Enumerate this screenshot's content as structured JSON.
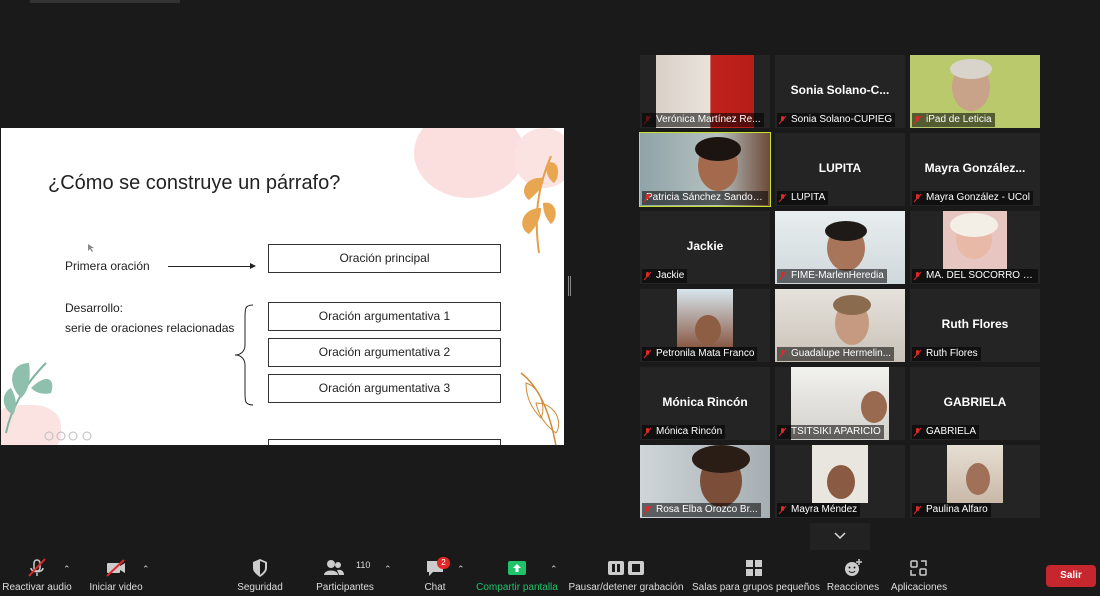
{
  "slide": {
    "title": "¿Cómo se construye un párrafo?",
    "left_labels": {
      "primera": "Primera oración",
      "desarrollo": "Desarrollo:",
      "serie": "serie de oraciones relacionadas"
    },
    "boxes": [
      "Oración principal",
      "Oración argumentativa 1",
      "Oración argumentativa 2",
      "Oración argumentativa 3"
    ]
  },
  "participants": [
    {
      "name": "Verónica Martínez Re...",
      "big": ""
    },
    {
      "name": "Sonia Solano-CUPIEG",
      "big": "Sonia  Solano-C..."
    },
    {
      "name": "iPad de Leticia",
      "big": ""
    },
    {
      "name": "Patricia Sánchez Sandoval",
      "big": ""
    },
    {
      "name": "LUPITA",
      "big": "LUPITA"
    },
    {
      "name": "Mayra González - UCol",
      "big": "Mayra  González..."
    },
    {
      "name": "Jackie",
      "big": "Jackie"
    },
    {
      "name": "FIME-MarlenHeredia",
      "big": ""
    },
    {
      "name": "MA. DEL SOCORRO 7...",
      "big": ""
    },
    {
      "name": "Petronila Mata Franco",
      "big": ""
    },
    {
      "name": "Guadalupe Hermelin...",
      "big": ""
    },
    {
      "name": "Ruth Flores",
      "big": "Ruth Flores"
    },
    {
      "name": "Mónica Rincón",
      "big": "Mónica Rincón"
    },
    {
      "name": "TSITSIKI APARICIO",
      "big": ""
    },
    {
      "name": "GABRIELA",
      "big": "GABRIELA"
    },
    {
      "name": "Rosa Elba Orozco Br...",
      "big": ""
    },
    {
      "name": "Mayra Méndez",
      "big": ""
    },
    {
      "name": "Paulina Alfaro",
      "big": ""
    }
  ],
  "toolbar": {
    "unmute": "Reactivar audio",
    "start_video": "Iniciar video",
    "security": "Seguridad",
    "participants": "Participantes",
    "participants_count": "110",
    "chat": "Chat",
    "chat_badge": "2",
    "share": "Compartir pantalla",
    "record": "Pausar/detener grabación",
    "breakout": "Salas para grupos pequeños",
    "reactions": "Reacciones",
    "apps": "Aplicaciones",
    "leave": "Salir"
  },
  "colors": {
    "active_speaker": "#c7e02a",
    "share_green": "#1ec36a",
    "leave_red": "#c6262e",
    "muted_red": "#e02828"
  }
}
